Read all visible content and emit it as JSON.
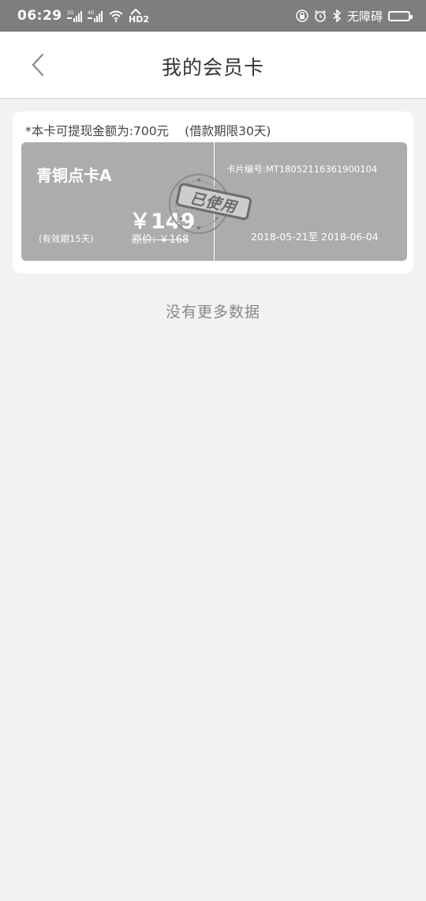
{
  "status_bar": {
    "time": "06:29",
    "signal1_label": "2G",
    "signal2_label": "4G",
    "hd_label": "HD2",
    "accessibility_label": "无障碍",
    "icons": [
      "signal-icon",
      "wifi-icon",
      "hd-icon",
      "lock-icon",
      "alarm-icon",
      "bluetooth-icon",
      "battery-icon"
    ]
  },
  "header": {
    "title": "我的会员卡",
    "back_icon": "chevron-left-icon"
  },
  "card": {
    "note": "*本卡可提现金额为:700元",
    "note_term": "(借款期限30天)",
    "name": "青铜点卡A",
    "validity": "(有效期15天)",
    "price": "￥149",
    "original_price": "原价: ￥168",
    "number": "卡片编号:MT18052116361900104",
    "period": "2018-05-21至 2018-06-04",
    "stamp_text": "已使用"
  },
  "footer": {
    "no_more": "没有更多数据"
  }
}
